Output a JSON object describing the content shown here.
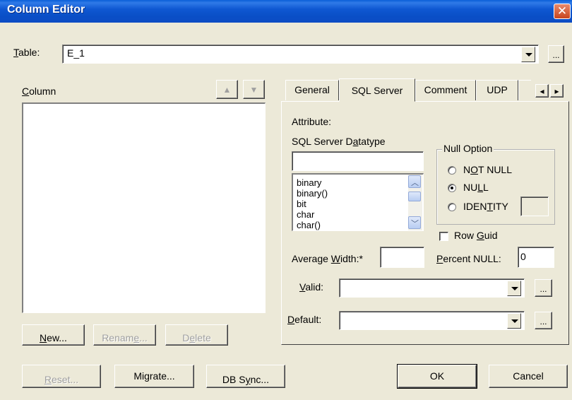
{
  "window": {
    "title": "Column Editor",
    "close_glyph": "✕"
  },
  "table": {
    "label_key": "T",
    "label_rest": "able:",
    "value": "E_1",
    "browse_label": "..."
  },
  "column": {
    "label_key": "C",
    "label_rest": "olumn",
    "up_glyph": "▲",
    "down_glyph": "▼"
  },
  "column_buttons": {
    "new_key": "N",
    "new_rest": "ew...",
    "rename_pre": "Renam",
    "rename_key": "e",
    "rename_rest": "...",
    "delete_pre": "D",
    "delete_key": "e",
    "delete_rest": "lete"
  },
  "tabs": {
    "items": [
      "General",
      "SQL Server",
      "Comment",
      "UDP"
    ],
    "active": "SQL Server",
    "scroll_left": "◂",
    "scroll_right": "▸"
  },
  "sql": {
    "attribute_label": "Attribute:",
    "datatype_label_pre": "SQL Server D",
    "datatype_label_key": "a",
    "datatype_label_rest": "tatype",
    "datatype_value": "",
    "datatypes": [
      "binary",
      "binary()",
      "bit",
      "char",
      "char()"
    ],
    "null_option": {
      "group_label": "Null Option",
      "not_null_pre": "N",
      "not_null_key": "O",
      "not_null_rest": "T NULL",
      "null_pre": "NU",
      "null_key": "L",
      "null_rest": "L",
      "identity_pre": "IDEN",
      "identity_key": "T",
      "identity_rest": "ITY",
      "selected": "NULL"
    },
    "row_guid_pre": "Row ",
    "row_guid_key": "G",
    "row_guid_rest": "uid",
    "average_width_pre": "Average ",
    "average_width_key": "W",
    "average_width_rest": "idth:*",
    "average_width_value": "",
    "percent_null_key": "P",
    "percent_null_rest": "ercent NULL:",
    "percent_null_value": "0",
    "valid_key": "V",
    "valid_rest": "alid:",
    "valid_value": "",
    "default_key": "D",
    "default_rest": "efault:",
    "default_value": "",
    "browse_label": "..."
  },
  "footer": {
    "reset_key": "R",
    "reset_rest": "eset...",
    "migrate_label": "Migrate...",
    "dbsync_pre": "DB S",
    "dbsync_key": "y",
    "dbsync_rest": "nc...",
    "ok_label": "OK",
    "cancel_label": "Cancel"
  },
  "colors": {
    "title_bar": "#0a4fc7",
    "dialog_bg": "#ece9d8",
    "close_button": "#c9451e"
  }
}
